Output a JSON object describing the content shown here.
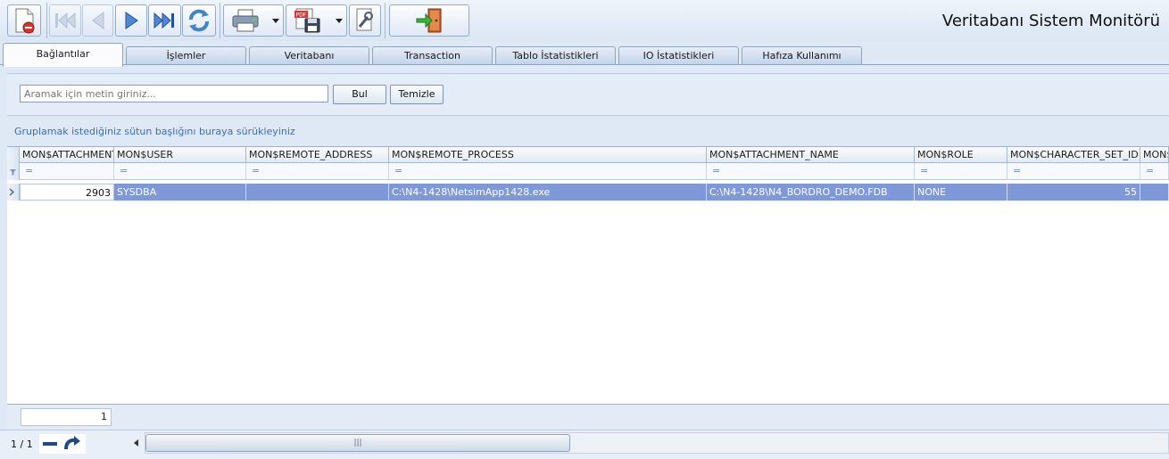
{
  "app": {
    "title": "Veritabanı Sistem Monitörü"
  },
  "toolbar": {
    "buttons": [
      {
        "icon": "close-document-icon"
      },
      {
        "icon": "first-record-icon"
      },
      {
        "icon": "previous-record-icon"
      },
      {
        "icon": "next-record-icon"
      },
      {
        "icon": "last-record-icon"
      },
      {
        "icon": "refresh-icon"
      },
      {
        "icon": "printer-icon"
      },
      {
        "icon": "pdf-export-icon"
      },
      {
        "icon": "settings-wrench-icon"
      },
      {
        "icon": "exit-door-icon"
      }
    ]
  },
  "tabs": [
    {
      "label": "Bağlantılar",
      "active": true
    },
    {
      "label": "İşlemler"
    },
    {
      "label": "Veritabanı"
    },
    {
      "label": "Transaction"
    },
    {
      "label": "Tablo İstatistikleri"
    },
    {
      "label": "IO İstatistikleri"
    },
    {
      "label": "Hafıza Kullanımı"
    }
  ],
  "search": {
    "placeholder": "Aramak için metin giriniz...",
    "find_label": "Bul",
    "clear_label": "Temizle"
  },
  "group_hint": "Gruplamak istediğiniz sütun başlığını buraya sürükleyiniz",
  "grid": {
    "columns": [
      "MON$ATTACHMENT_",
      "MON$USER",
      "MON$REMOTE_ADDRESS",
      "MON$REMOTE_PROCESS",
      "MON$ATTACHMENT_NAME",
      "MON$ROLE",
      "MON$CHARACTER_SET_ID",
      "MON$S"
    ],
    "filter_symbol": "=",
    "rows": [
      [
        "2903",
        "SYSDBA",
        "",
        "C:\\N4-1428\\NetsimApp1428.exe",
        "C:\\N4-1428\\N4_BORDRO_DEMO.FDB",
        "NONE",
        "55",
        ""
      ]
    ]
  },
  "footer": {
    "count": "1"
  },
  "status": {
    "page_info": "1 / 1"
  },
  "colors": {
    "selection": "#7f99d8",
    "accent": "#3d6db3"
  }
}
